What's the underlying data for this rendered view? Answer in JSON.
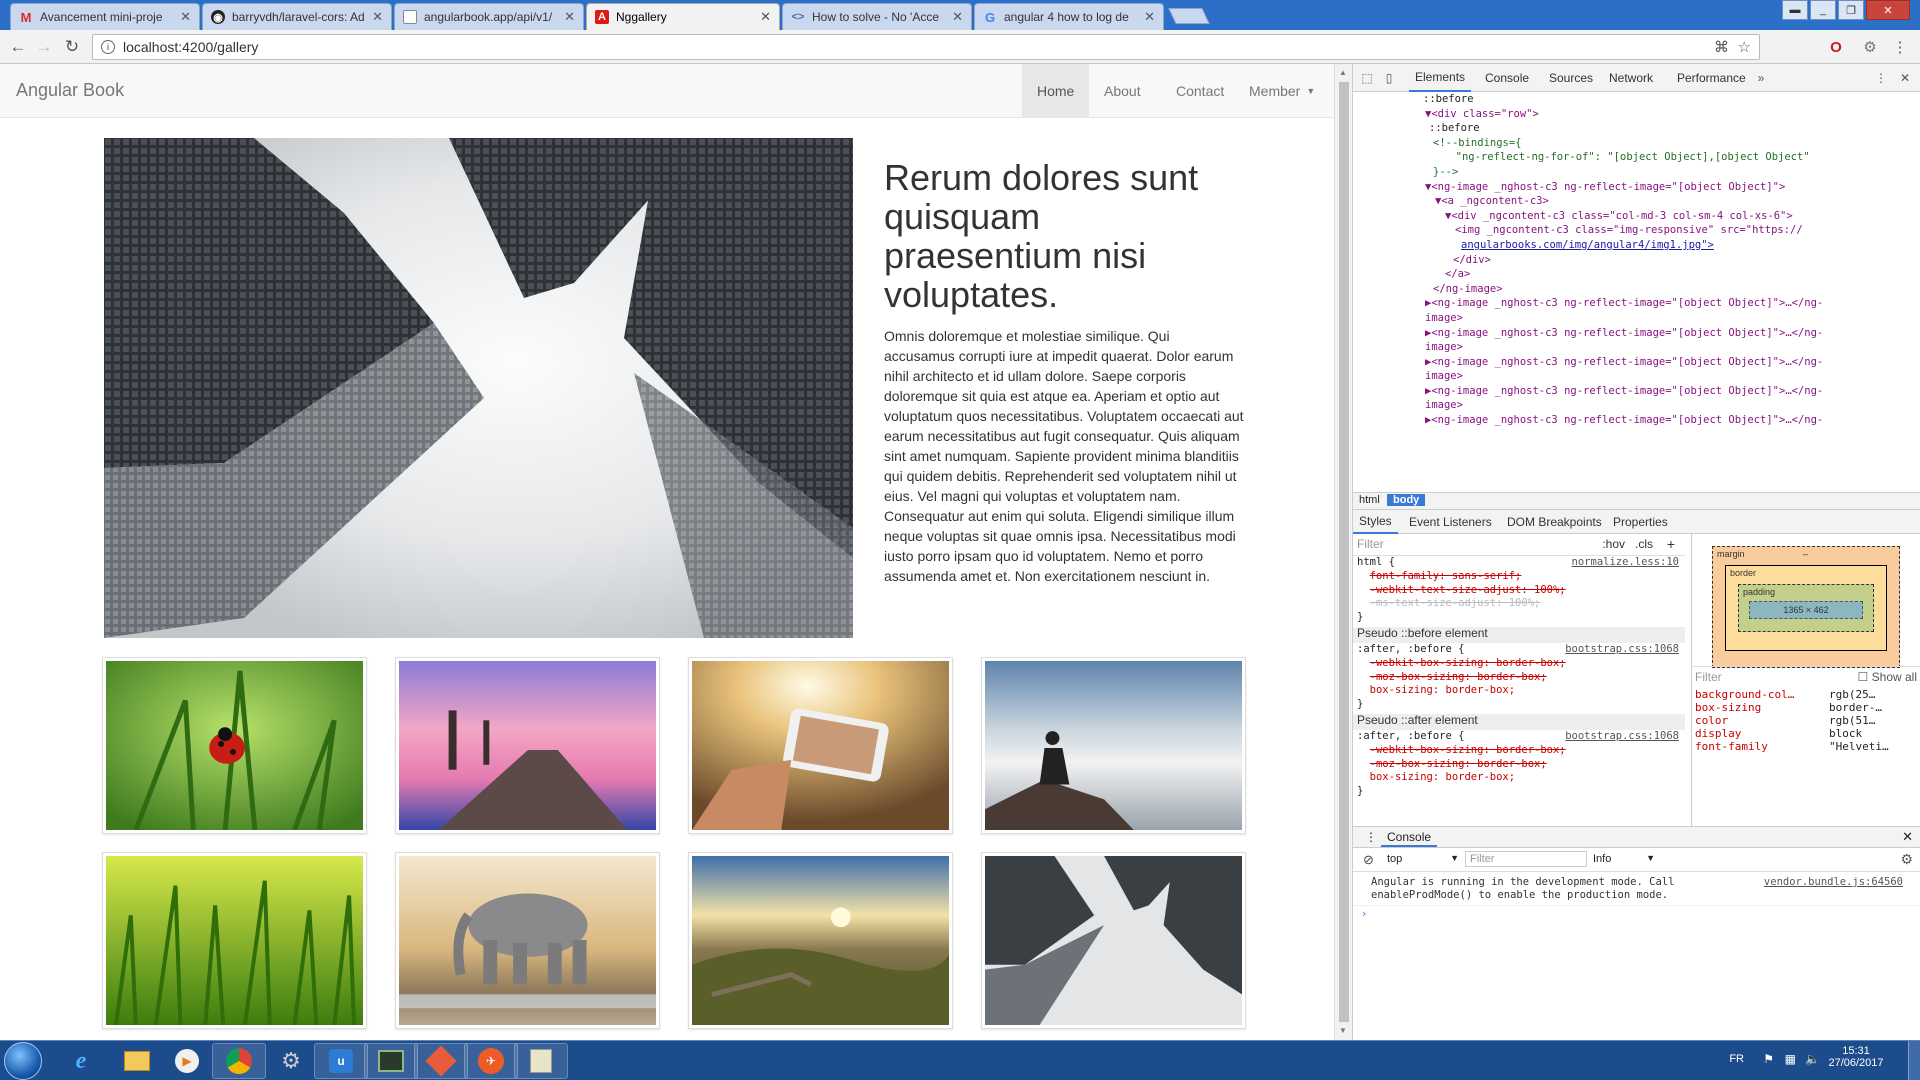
{
  "browser": {
    "tabs": [
      {
        "title": "Avancement mini-proje",
        "favicon": "gmail-icon",
        "active": false
      },
      {
        "title": "barryvdh/laravel-cors: Ad",
        "favicon": "github-icon",
        "active": false
      },
      {
        "title": "angularbook.app/api/v1/",
        "favicon": "page-icon",
        "active": false
      },
      {
        "title": "Nggallery",
        "favicon": "angular-icon",
        "active": true
      },
      {
        "title": "How to solve - No 'Acce",
        "favicon": "code-icon",
        "active": false
      },
      {
        "title": "angular 4 how to log de",
        "favicon": "google-icon",
        "active": false
      }
    ],
    "url": "localhost:4200/gallery"
  },
  "page": {
    "brand": "Angular Book",
    "nav": [
      {
        "label": "Home",
        "active": true
      },
      {
        "label": "About",
        "active": false
      },
      {
        "label": "Contact",
        "active": false
      },
      {
        "label": "Member",
        "active": false,
        "dropdown": true
      }
    ],
    "hero": {
      "title": "Rerum dolores sunt quisquam praesentium nisi voluptates.",
      "body": "Omnis doloremque et molestiae similique. Qui accusamus corrupti iure at impedit quaerat. Dolor earum nihil architecto et id ullam dolore. Saepe corporis doloremque sit quia est atque ea. Aperiam et optio aut voluptatum quos necessitatibus. Voluptatem occaecati aut earum necessitatibus aut fugit consequatur. Quis aliquam sint amet numquam. Sapiente provident minima blanditiis qui quidem debitis. Reprehenderit sed voluptatem nihil ut eius. Vel magni qui voluptas et voluptatem nam. Consequatur aut enim qui soluta. Eligendi similique illum neque voluptas sit quae omnis ipsa. Necessitatibus modi iusto porro ipsam quo id voluptatem. Nemo et porro assumenda amet et. Non exercitationem nesciunt in."
    },
    "gallery": [
      "ladybug-photo",
      "pier-sunset-photo",
      "phone-sunlight-photo",
      "man-above-clouds-photo",
      "grass-photo",
      "elephant-photo",
      "valley-sunset-photo",
      "skyscrapers-photo"
    ]
  },
  "devtools": {
    "tabs": [
      "Elements",
      "Console",
      "Sources",
      "Network",
      "Performance"
    ],
    "active_tab": "Elements",
    "dom_lines": [
      {
        "t": "::before",
        "cls": "tx"
      },
      {
        "t": "▼<div class=\"row\">",
        "cls": "tg"
      },
      {
        "t": "::before",
        "cls": "tx"
      },
      {
        "t": "<!--bindings={",
        "cls": "cm"
      },
      {
        "t": "  \"ng-reflect-ng-for-of\": \"[object Object],[object Object\"",
        "cls": "cm"
      },
      {
        "t": "}-->",
        "cls": "cm"
      },
      {
        "t": "▼<ng-image _nghost-c3 ng-reflect-image=\"[object Object]\">",
        "cls": "tg"
      },
      {
        "t": "▼<a _ngcontent-c3>",
        "cls": "tg"
      },
      {
        "t": "▼<div _ngcontent-c3 class=\"col-md-3 col-sm-4 col-xs-6\">",
        "cls": "tg"
      },
      {
        "t": "<img _ngcontent-c3 class=\"img-responsive\" src=\"https://",
        "cls": "tg"
      },
      {
        "t": "angularbooks.com/img/angular4/img1.jpg\">",
        "cls": "ln"
      },
      {
        "t": "</div>",
        "cls": "tg"
      },
      {
        "t": "</a>",
        "cls": "tg"
      },
      {
        "t": "</ng-image>",
        "cls": "tg"
      },
      {
        "t": "▶<ng-image _nghost-c3 ng-reflect-image=\"[object Object]\">…</ng-",
        "cls": "tg"
      },
      {
        "t": "image>",
        "cls": "tg"
      },
      {
        "t": "▶<ng-image _nghost-c3 ng-reflect-image=\"[object Object]\">…</ng-",
        "cls": "tg"
      },
      {
        "t": "image>",
        "cls": "tg"
      },
      {
        "t": "▶<ng-image _nghost-c3 ng-reflect-image=\"[object Object]\">…</ng-",
        "cls": "tg"
      },
      {
        "t": "image>",
        "cls": "tg"
      },
      {
        "t": "▶<ng-image _nghost-c3 ng-reflect-image=\"[object Object]\">…</ng-",
        "cls": "tg"
      },
      {
        "t": "image>",
        "cls": "tg"
      },
      {
        "t": "▶<ng-image _nghost-c3 ng-reflect-image=\"[object Object]\">…</ng-",
        "cls": "tg"
      }
    ],
    "breadcrumbs": [
      "html",
      "body"
    ],
    "style_tabs": [
      "Styles",
      "Event Listeners",
      "DOM Breakpoints",
      "Properties"
    ],
    "filter_placeholder": "Filter",
    "hov": ":hov",
    "cls": ".cls",
    "rules": {
      "html_selector": "html {",
      "html_source": "normalize.less:10",
      "html_props": [
        "font-family: sans-serif;",
        "-webkit-text-size-adjust: 100%;",
        "-ms-text-size-adjust: 100%;"
      ],
      "before_header": "Pseudo ::before element",
      "before_selector": ":after, :before {",
      "before_source": "bootstrap.css:1068",
      "before_props": [
        "-webkit-box-sizing: border-box;",
        "-moz-box-sizing: border-box;",
        "box-sizing: border-box;"
      ],
      "after_header": "Pseudo ::after element",
      "after_selector": ":after, :before {",
      "after_source": "bootstrap.css:1068",
      "after_props": [
        "-webkit-box-sizing: border-box;",
        "-moz-box-sizing: border-box;",
        "box-sizing: border-box;"
      ]
    },
    "box_model": {
      "margin": "margin",
      "border": "border",
      "padding": "padding",
      "content": "1365 × 462",
      "dash": "–"
    },
    "computed_filter": "Filter",
    "show_all": "Show all",
    "computed": [
      {
        "prop": "background-col…",
        "val": "rgb(25…"
      },
      {
        "prop": "box-sizing",
        "val": "border-…"
      },
      {
        "prop": "color",
        "val": "rgb(51…"
      },
      {
        "prop": "display",
        "val": "block"
      },
      {
        "prop": "font-family",
        "val": "\"Helveti…"
      }
    ],
    "console": {
      "title": "Console",
      "context": "top",
      "filter": "Filter",
      "level": "Info",
      "message": "Angular is running in the development mode. Call enableProdMode() to enable the production mode.",
      "msg_line1": "Angular is running in the development mode. Call",
      "msg_line2": "enableProdMode() to enable the production mode.",
      "source": "vendor.bundle.js:64560"
    }
  },
  "taskbar": {
    "lang": "FR",
    "time": "15:31",
    "date": "27/06/2017"
  }
}
